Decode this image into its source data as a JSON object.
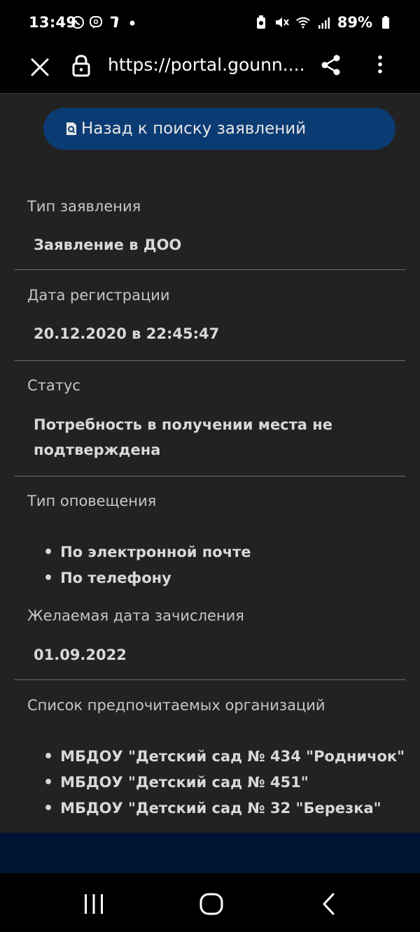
{
  "status_bar": {
    "time": "13:49",
    "left_icons": [
      "whatsapp-icon",
      "viber-icon",
      "app-icon",
      "dot-icon"
    ],
    "right_icons": [
      "battery-saver-icon",
      "mute-icon",
      "wifi-icon",
      "signal-icon"
    ],
    "battery": "89%"
  },
  "browser": {
    "url": "https://portal.gounn....",
    "icons": [
      "close-icon",
      "lock-icon",
      "share-icon",
      "more-icon"
    ]
  },
  "back_button": {
    "label": "Назад к поиску заявлений",
    "icon": "search-document-icon",
    "color": "#0b3b73"
  },
  "fields": {
    "type": {
      "label": "Тип заявления",
      "value": "Заявление в ДОО"
    },
    "reg_date": {
      "label": "Дата регистрации",
      "value": "20.12.2020 в 22:45:47"
    },
    "status": {
      "label": "Статус",
      "value_line1": "Потребность в получении места не",
      "value_line2": "подтверждена"
    },
    "notify": {
      "label": "Тип оповещения",
      "items": [
        "По электронной почте",
        "По телефону"
      ]
    },
    "desired_date": {
      "label": "Желаемая дата зачисления",
      "value": "01.09.2022"
    },
    "orgs": {
      "label": "Список предпочитаемых организаций",
      "items": [
        "МБДОУ \"Детский сад № 434 \"Родничок\"",
        "МБДОУ \"Детский сад № 451\"",
        "МБДОУ \"Детский сад № 32 \"Березка\""
      ]
    }
  },
  "colors": {
    "background": "#222222",
    "footer": "#001433",
    "divider": "#6e6e6e"
  }
}
